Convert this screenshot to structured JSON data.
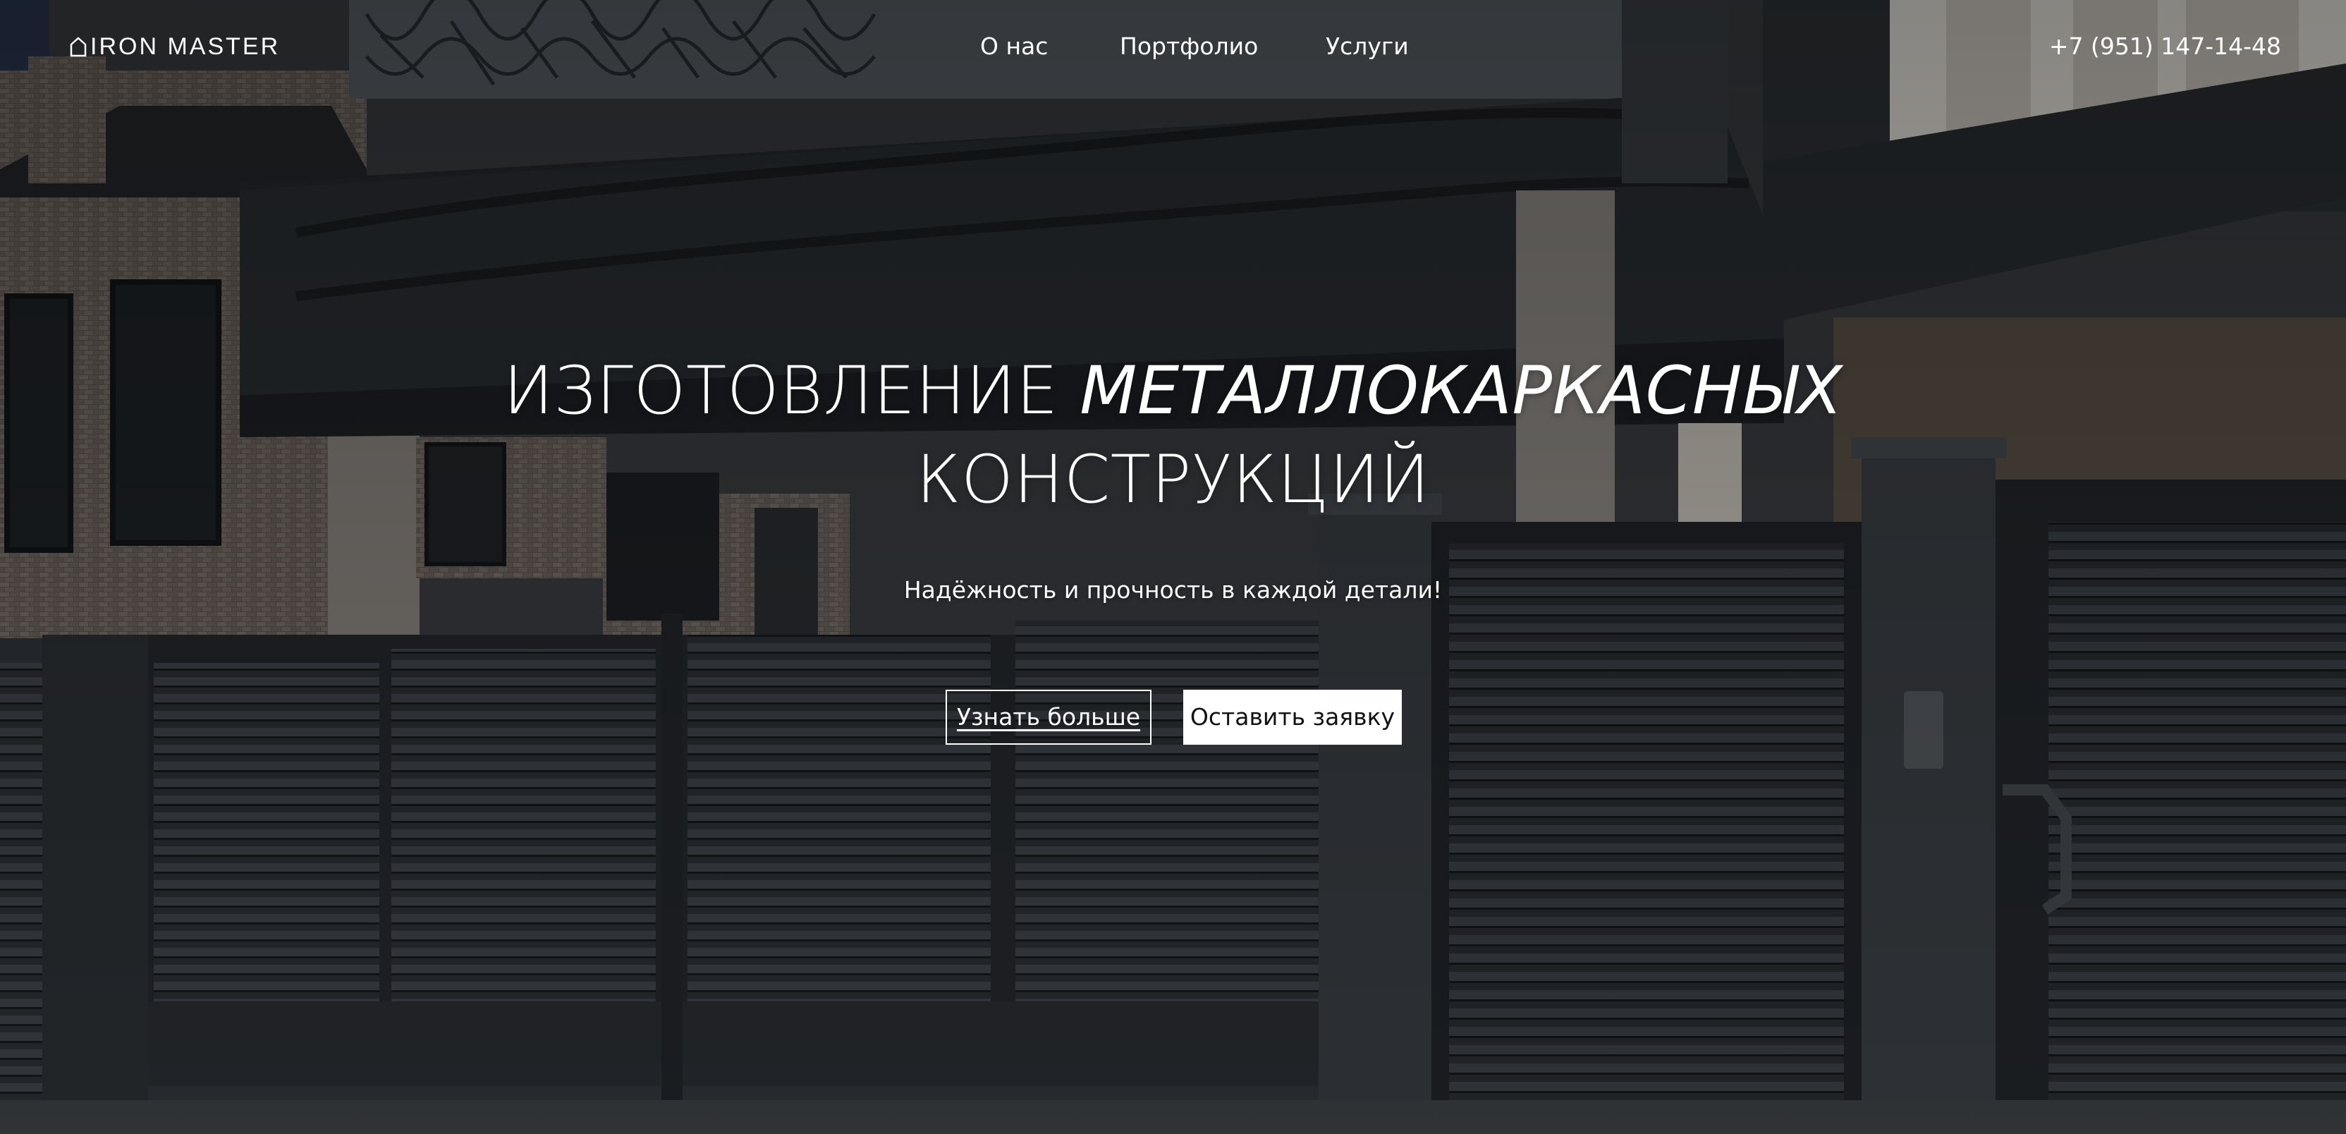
{
  "header": {
    "logo_text": "IRON MASTER",
    "logo_icon": "house-outline-icon",
    "nav": [
      "О нас",
      "Портфолио",
      "Услуги"
    ],
    "phone": "+7 (951) 147-14-48"
  },
  "hero": {
    "title_line1_regular": "ИЗГОТОВЛЕНИЕ",
    "title_line1_italic": "МЕТАЛЛОКАРКАСНЫХ",
    "title_line2": "КОНСТРУКЦИЙ",
    "subtitle": "Надёжность и прочность в каждой детали!",
    "buttons": {
      "learn_more": "Узнать больше",
      "request": "Оставить заявку"
    }
  },
  "colors": {
    "text": "#ffffff",
    "overlay": "#0d0f12",
    "button_fill": "#ffffff",
    "button_text": "#111111"
  }
}
